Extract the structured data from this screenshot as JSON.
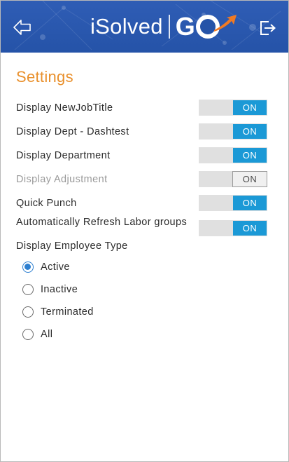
{
  "header": {
    "brand_name": "iSolved",
    "brand_suffix_g": "G",
    "back_icon": "back-arrow-icon",
    "logout_icon": "logout-icon",
    "background_color": "#2553a8",
    "accent_color": "#f07a23"
  },
  "page": {
    "title": "Settings",
    "title_color": "#e9902c"
  },
  "settings": [
    {
      "label": "Display NewJobTitle",
      "state": "ON",
      "enabled": true
    },
    {
      "label": "Display Dept - Dashtest",
      "state": "ON",
      "enabled": true
    },
    {
      "label": "Display Department",
      "state": "ON",
      "enabled": true
    },
    {
      "label": "Display Adjustment",
      "state": "ON",
      "enabled": false
    },
    {
      "label": "Quick Punch",
      "state": "ON",
      "enabled": true
    },
    {
      "label": "Automatically Refresh Labor groups",
      "state": "ON",
      "enabled": true
    }
  ],
  "employee_type": {
    "label": "Display Employee Type",
    "options": [
      {
        "label": "Active",
        "selected": true
      },
      {
        "label": "Inactive",
        "selected": false
      },
      {
        "label": "Terminated",
        "selected": false
      },
      {
        "label": "All",
        "selected": false
      }
    ]
  },
  "colors": {
    "toggle_on": "#1b99d6",
    "toggle_track": "#e0e0e0",
    "radio_selected": "#2d7fd0"
  }
}
